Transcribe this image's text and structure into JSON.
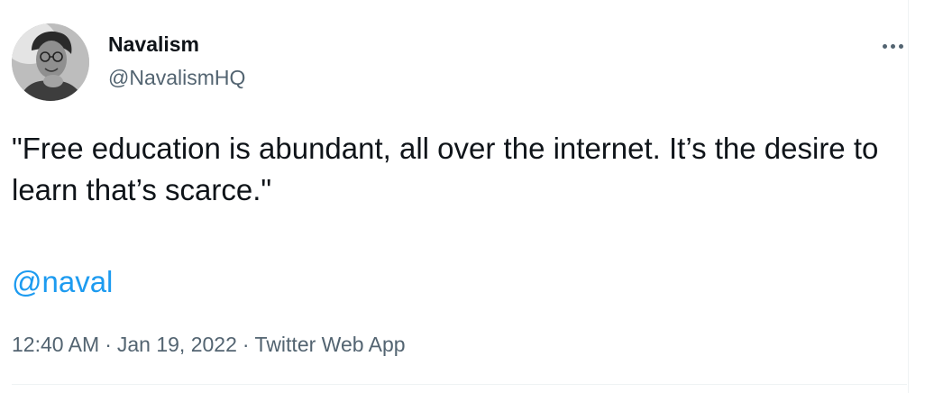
{
  "author": {
    "name": "Navalism",
    "handle": "@NavalismHQ"
  },
  "tweet": {
    "text": "\"Free education is abundant, all over the internet. It’s the desire to learn that’s scarce.\"",
    "mention": "@naval"
  },
  "meta": {
    "time": "12:40 AM",
    "separator": "·",
    "date": "Jan 19, 2022",
    "source": "Twitter Web App"
  },
  "icons": {
    "more": "more-options-icon",
    "avatar": "avatar"
  },
  "colors": {
    "primary_text": "#0f1419",
    "secondary_text": "#536471",
    "link": "#1d9bf0",
    "border": "#eff3f4"
  }
}
